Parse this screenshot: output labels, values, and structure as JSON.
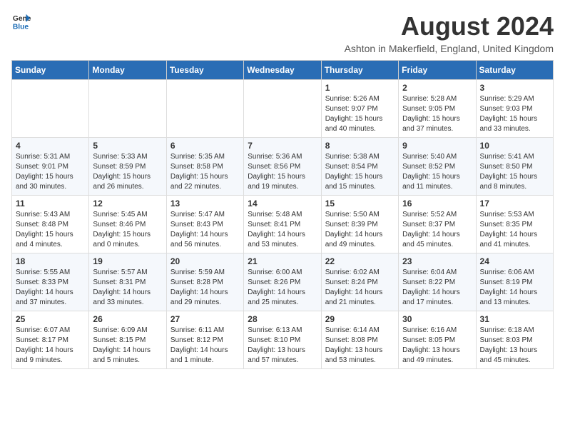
{
  "header": {
    "logo_line1": "General",
    "logo_line2": "Blue",
    "month_title": "August 2024",
    "location": "Ashton in Makerfield, England, United Kingdom"
  },
  "weekdays": [
    "Sunday",
    "Monday",
    "Tuesday",
    "Wednesday",
    "Thursday",
    "Friday",
    "Saturday"
  ],
  "weeks": [
    [
      {
        "day": "",
        "info": ""
      },
      {
        "day": "",
        "info": ""
      },
      {
        "day": "",
        "info": ""
      },
      {
        "day": "",
        "info": ""
      },
      {
        "day": "1",
        "info": "Sunrise: 5:26 AM\nSunset: 9:07 PM\nDaylight: 15 hours\nand 40 minutes."
      },
      {
        "day": "2",
        "info": "Sunrise: 5:28 AM\nSunset: 9:05 PM\nDaylight: 15 hours\nand 37 minutes."
      },
      {
        "day": "3",
        "info": "Sunrise: 5:29 AM\nSunset: 9:03 PM\nDaylight: 15 hours\nand 33 minutes."
      }
    ],
    [
      {
        "day": "4",
        "info": "Sunrise: 5:31 AM\nSunset: 9:01 PM\nDaylight: 15 hours\nand 30 minutes."
      },
      {
        "day": "5",
        "info": "Sunrise: 5:33 AM\nSunset: 8:59 PM\nDaylight: 15 hours\nand 26 minutes."
      },
      {
        "day": "6",
        "info": "Sunrise: 5:35 AM\nSunset: 8:58 PM\nDaylight: 15 hours\nand 22 minutes."
      },
      {
        "day": "7",
        "info": "Sunrise: 5:36 AM\nSunset: 8:56 PM\nDaylight: 15 hours\nand 19 minutes."
      },
      {
        "day": "8",
        "info": "Sunrise: 5:38 AM\nSunset: 8:54 PM\nDaylight: 15 hours\nand 15 minutes."
      },
      {
        "day": "9",
        "info": "Sunrise: 5:40 AM\nSunset: 8:52 PM\nDaylight: 15 hours\nand 11 minutes."
      },
      {
        "day": "10",
        "info": "Sunrise: 5:41 AM\nSunset: 8:50 PM\nDaylight: 15 hours\nand 8 minutes."
      }
    ],
    [
      {
        "day": "11",
        "info": "Sunrise: 5:43 AM\nSunset: 8:48 PM\nDaylight: 15 hours\nand 4 minutes."
      },
      {
        "day": "12",
        "info": "Sunrise: 5:45 AM\nSunset: 8:46 PM\nDaylight: 15 hours\nand 0 minutes."
      },
      {
        "day": "13",
        "info": "Sunrise: 5:47 AM\nSunset: 8:43 PM\nDaylight: 14 hours\nand 56 minutes."
      },
      {
        "day": "14",
        "info": "Sunrise: 5:48 AM\nSunset: 8:41 PM\nDaylight: 14 hours\nand 53 minutes."
      },
      {
        "day": "15",
        "info": "Sunrise: 5:50 AM\nSunset: 8:39 PM\nDaylight: 14 hours\nand 49 minutes."
      },
      {
        "day": "16",
        "info": "Sunrise: 5:52 AM\nSunset: 8:37 PM\nDaylight: 14 hours\nand 45 minutes."
      },
      {
        "day": "17",
        "info": "Sunrise: 5:53 AM\nSunset: 8:35 PM\nDaylight: 14 hours\nand 41 minutes."
      }
    ],
    [
      {
        "day": "18",
        "info": "Sunrise: 5:55 AM\nSunset: 8:33 PM\nDaylight: 14 hours\nand 37 minutes."
      },
      {
        "day": "19",
        "info": "Sunrise: 5:57 AM\nSunset: 8:31 PM\nDaylight: 14 hours\nand 33 minutes."
      },
      {
        "day": "20",
        "info": "Sunrise: 5:59 AM\nSunset: 8:28 PM\nDaylight: 14 hours\nand 29 minutes."
      },
      {
        "day": "21",
        "info": "Sunrise: 6:00 AM\nSunset: 8:26 PM\nDaylight: 14 hours\nand 25 minutes."
      },
      {
        "day": "22",
        "info": "Sunrise: 6:02 AM\nSunset: 8:24 PM\nDaylight: 14 hours\nand 21 minutes."
      },
      {
        "day": "23",
        "info": "Sunrise: 6:04 AM\nSunset: 8:22 PM\nDaylight: 14 hours\nand 17 minutes."
      },
      {
        "day": "24",
        "info": "Sunrise: 6:06 AM\nSunset: 8:19 PM\nDaylight: 14 hours\nand 13 minutes."
      }
    ],
    [
      {
        "day": "25",
        "info": "Sunrise: 6:07 AM\nSunset: 8:17 PM\nDaylight: 14 hours\nand 9 minutes."
      },
      {
        "day": "26",
        "info": "Sunrise: 6:09 AM\nSunset: 8:15 PM\nDaylight: 14 hours\nand 5 minutes."
      },
      {
        "day": "27",
        "info": "Sunrise: 6:11 AM\nSunset: 8:12 PM\nDaylight: 14 hours\nand 1 minute."
      },
      {
        "day": "28",
        "info": "Sunrise: 6:13 AM\nSunset: 8:10 PM\nDaylight: 13 hours\nand 57 minutes."
      },
      {
        "day": "29",
        "info": "Sunrise: 6:14 AM\nSunset: 8:08 PM\nDaylight: 13 hours\nand 53 minutes."
      },
      {
        "day": "30",
        "info": "Sunrise: 6:16 AM\nSunset: 8:05 PM\nDaylight: 13 hours\nand 49 minutes."
      },
      {
        "day": "31",
        "info": "Sunrise: 6:18 AM\nSunset: 8:03 PM\nDaylight: 13 hours\nand 45 minutes."
      }
    ]
  ]
}
